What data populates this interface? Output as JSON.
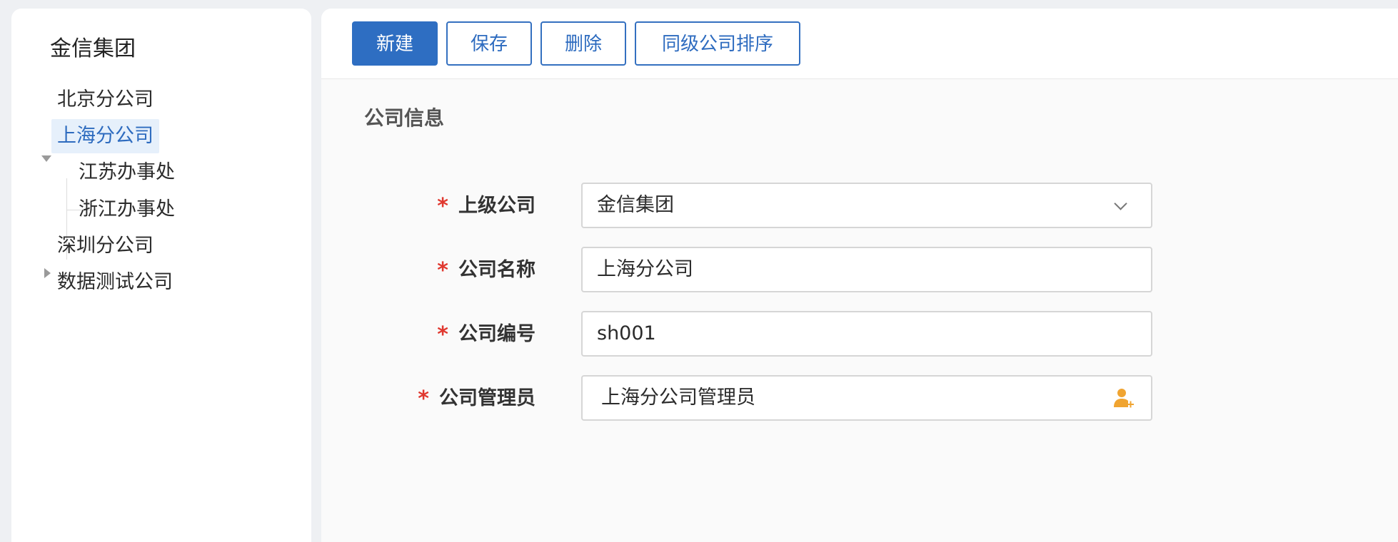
{
  "tree": {
    "root": "金信集团",
    "nodes": [
      {
        "label": "北京分公司"
      },
      {
        "label": "上海分公司",
        "expanded": true,
        "selected": true
      },
      {
        "label": "江苏办事处"
      },
      {
        "label": "浙江办事处"
      },
      {
        "label": "深圳分公司"
      },
      {
        "label": "数据测试公司",
        "collapsed": true
      }
    ]
  },
  "toolbar": {
    "new_label": "新建",
    "save_label": "保存",
    "delete_label": "删除",
    "sort_label": "同级公司排序",
    "primary_color": "#2e6ec2"
  },
  "section": {
    "title": "公司信息"
  },
  "form": {
    "required_mark": "*",
    "parent_company": {
      "label": "上级公司",
      "value": "金信集团"
    },
    "company_name": {
      "label": "公司名称",
      "value": "上海分公司"
    },
    "company_code": {
      "label": "公司编号",
      "value": "sh001"
    },
    "company_admin": {
      "label": "公司管理员",
      "value": "上海分公司管理员",
      "icon": "add-user-icon"
    }
  },
  "colors": {
    "required": "#e0382f",
    "selected_bg": "#e6f0fb",
    "selected_text": "#2d6bbf",
    "icon_orange": "#f0a431"
  }
}
